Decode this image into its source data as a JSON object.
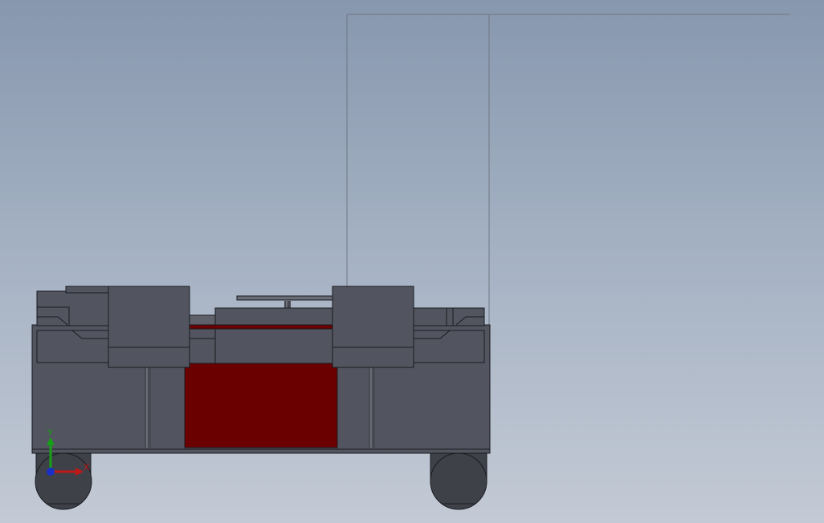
{
  "viewport": {
    "background_top": "#8797ae",
    "background_bottom": "#c3cad5"
  },
  "model": {
    "body_color": "#52545f",
    "edge_color": "#1a1b20",
    "highlight_color": "#6a0000",
    "wheel_color": "#3f4148"
  },
  "triad": {
    "x_label": "X",
    "y_label": "Y",
    "x_color": "#c01818",
    "y_color": "#16a016",
    "z_color": "#1a2fc8"
  }
}
